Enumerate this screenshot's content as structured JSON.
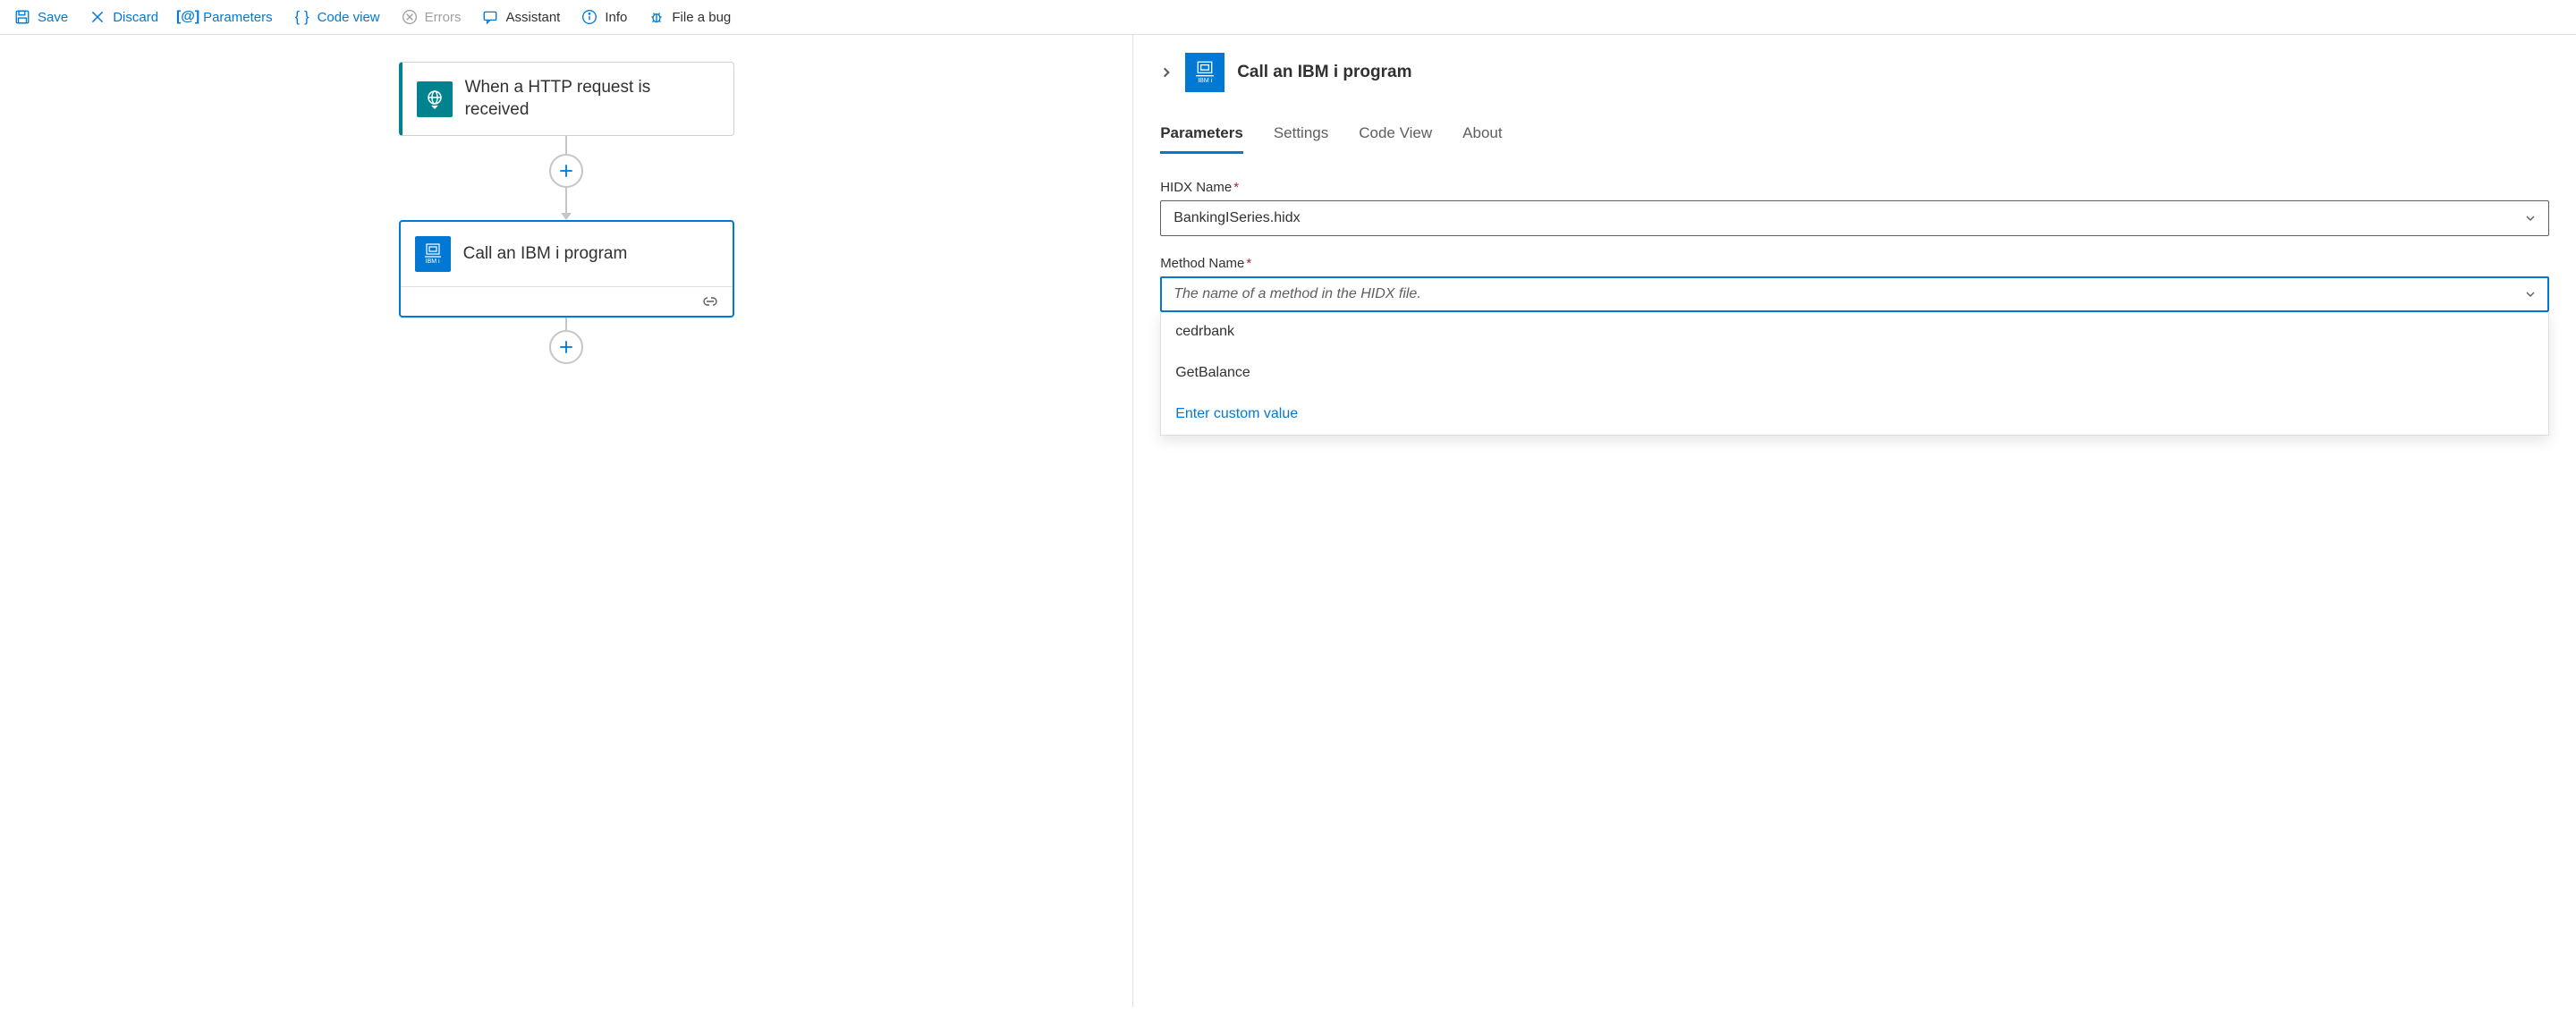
{
  "toolbar": {
    "save": "Save",
    "discard": "Discard",
    "parameters": "Parameters",
    "code_view": "Code view",
    "errors": "Errors",
    "assistant": "Assistant",
    "info": "Info",
    "file_bug": "File a bug"
  },
  "flow": {
    "trigger_title": "When a HTTP request is received",
    "action_title": "Call an IBM i program",
    "action_badge": "IBM i"
  },
  "panel": {
    "title": "Call an IBM i program",
    "badge": "IBM i",
    "tabs": {
      "parameters": "Parameters",
      "settings": "Settings",
      "code_view": "Code View",
      "about": "About"
    },
    "fields": {
      "hidx_label": "HIDX Name",
      "hidx_value": "BankingISeries.hidx",
      "method_label": "Method Name",
      "method_placeholder": "The name of a method in the HIDX file."
    },
    "dropdown": {
      "option1": "cedrbank",
      "option2": "GetBalance",
      "custom": "Enter custom value"
    }
  }
}
